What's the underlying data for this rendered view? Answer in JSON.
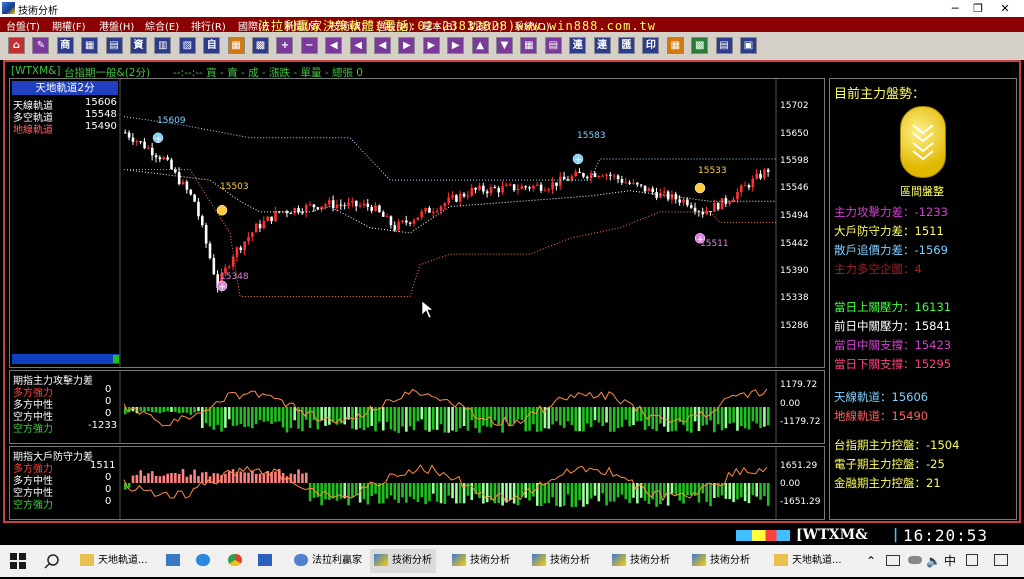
{
  "window": {
    "title": "技術分析",
    "minimize": "─",
    "restore": "❐",
    "close": "✕"
  },
  "menu": {
    "items": [
      "台盤(T)",
      "期權(F)",
      "港盤(H)",
      "綜合(E)",
      "排行(R)",
      "國際(I)",
      "新聞(N)",
      "技術(A)",
      "選股(M)",
      "基本(B)",
      "功能(U)",
      "系統(O)"
    ],
    "banner": "法拉利贏家決策軟體(電話:02-23832828)www.win888.com.tw"
  },
  "toolbar": {
    "buttons": [
      "⌂",
      "✎",
      "商",
      "▦",
      "▤",
      "資",
      "▥",
      "▧",
      "自",
      "▦",
      "▩",
      "+",
      "−",
      "◀",
      "◀",
      "◀",
      "▶",
      "▶",
      "▶",
      "▲",
      "▼",
      "▦",
      "▤",
      "連",
      "連",
      "匯",
      "印",
      "▦",
      "▩",
      "▤",
      "▣"
    ],
    "colors": [
      "#c03030",
      "#7a3a9a",
      "#2c3c88",
      "#2c3c88",
      "#2c3c88",
      "#2c3c88",
      "#2c3c88",
      "#2c3c88",
      "#2c3c88",
      "#d07a10",
      "#2c3c88",
      "#7a3a9a",
      "#7a3a9a",
      "#7a3a9a",
      "#7a3a9a",
      "#7a3a9a",
      "#7a3a9a",
      "#7a3a9a",
      "#7a3a9a",
      "#7a3a9a",
      "#7a3a9a",
      "#7a3a9a",
      "#7a3a9a",
      "#2c3c88",
      "#2c3c88",
      "#2c3c88",
      "#2c3c88",
      "#d07a10",
      "#2c7a3a",
      "#2c3c88",
      "#2c3c88"
    ]
  },
  "header": {
    "symbol": "[WTXM&]",
    "name": "台指期一般&(2分)",
    "fields": "--:--:--  買  -  賣  -  成  -  漲跌  -  單量  -  總張 0"
  },
  "main_legend": {
    "title": "天地軌道2分",
    "rows": [
      {
        "label": "天線軌道",
        "value": "15606",
        "color": "#ffffff"
      },
      {
        "label": "多空軌道",
        "value": "15548",
        "color": "#ffffff"
      },
      {
        "label": "地線軌道",
        "value": "15490",
        "color": "#ff6060"
      }
    ]
  },
  "main_axis": {
    "ticks": [
      "15702",
      "15650",
      "15598",
      "15546",
      "15494",
      "15442",
      "15390",
      "15338",
      "15286"
    ]
  },
  "markers": {
    "m1": "15609",
    "m2": "15503",
    "m3": "15348",
    "m4": "15583",
    "m5": "15533",
    "m6": "15511"
  },
  "sub1": {
    "title": "期指主力攻擊力差",
    "rows": [
      {
        "label": "多方強力",
        "value": "0",
        "color": "#ff4040"
      },
      {
        "label": "多方中性",
        "value": "0",
        "color": "#ffffff"
      },
      {
        "label": "空方中性",
        "value": "0",
        "color": "#ffffff"
      },
      {
        "label": "空方強力",
        "value": "-1233",
        "color": "#40d040"
      }
    ],
    "axis": [
      "1179.72",
      "0.00",
      "-1179.72"
    ]
  },
  "sub2": {
    "title": "期指大戶防守力差",
    "rows": [
      {
        "label": "多方強力",
        "value": "1511",
        "color": "#ff4040"
      },
      {
        "label": "多方中性",
        "value": "0",
        "color": "#ffffff"
      },
      {
        "label": "空方中性",
        "value": "0",
        "color": "#ffffff"
      },
      {
        "label": "空方強力",
        "value": "0",
        "color": "#40d040"
      }
    ],
    "axis": [
      "1651.29",
      "0.00",
      "-1651.29"
    ]
  },
  "right_panel": {
    "title": "目前主力盤勢：",
    "badge": "區間盤整",
    "lines": [
      {
        "text": "主力攻擊力差：-1233",
        "color": "#d040d0"
      },
      {
        "text": "大戶防守力差：1511",
        "color": "#ffff60"
      },
      {
        "text": "散戶追價力差：-1569",
        "color": "#80d0ff"
      },
      {
        "text": "主力多空企圖：4",
        "color": "#a02020"
      },
      {
        "text": "當日上關壓力：16131",
        "color": "#40ff40"
      },
      {
        "text": "前日中關壓力：15841",
        "color": "#ffffff"
      },
      {
        "text": "當日中關支撐：15423",
        "color": "#d040d0"
      },
      {
        "text": "當日下關支撐：15295",
        "color": "#ff4080"
      },
      {
        "text": "天線軌道：15606",
        "color": "#80d0ff"
      },
      {
        "text": "地線軌道：15490",
        "color": "#ff6060"
      },
      {
        "text": "台指期主力控盤：-1504",
        "color": "#ffff60"
      },
      {
        "text": "電子期主力控盤：-25",
        "color": "#ffff60"
      },
      {
        "text": "金融期主力控盤：21",
        "color": "#ffff60"
      }
    ]
  },
  "status": {
    "symbol": "WTXM&",
    "time": "16:20:53"
  },
  "taskbar": {
    "items": [
      "天地軌道...",
      "法拉利贏家",
      "技術分析",
      "技術分析",
      "技術分析",
      "技術分析",
      "技術分析",
      "天地軌道..."
    ],
    "tray": "中"
  },
  "chart_data": {
    "type": "candlestick",
    "interval": "2分",
    "yaxis_ticks": [
      15702,
      15650,
      15598,
      15546,
      15494,
      15442,
      15390,
      15338,
      15286
    ],
    "series": [
      {
        "name": "天線軌道",
        "last": 15606
      },
      {
        "name": "多空軌道",
        "last": 15548
      },
      {
        "name": "地線軌道",
        "last": 15490
      }
    ],
    "annotations": [
      15609,
      15503,
      15348,
      15583,
      15533,
      15511
    ]
  }
}
